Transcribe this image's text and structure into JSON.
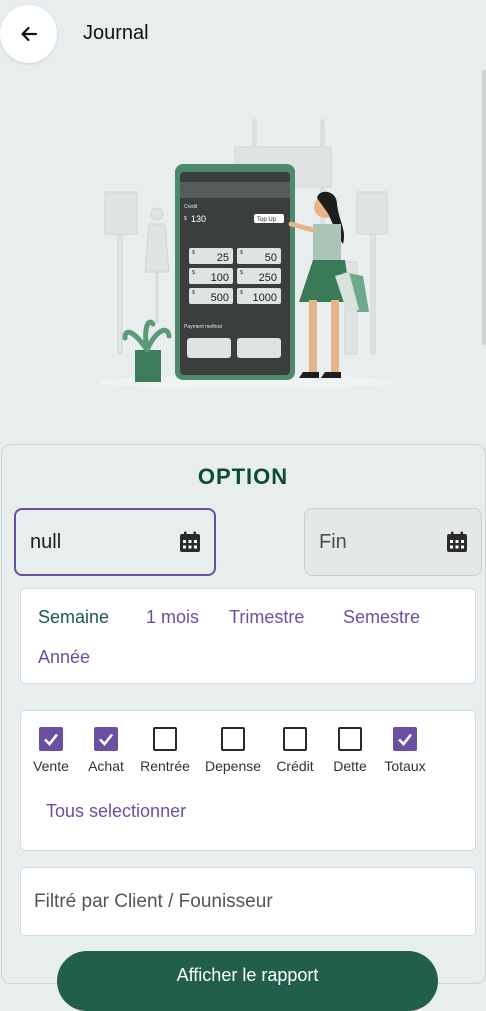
{
  "header": {
    "title": "Journal",
    "back_icon": "arrow-left-icon"
  },
  "illustration": {
    "credit_label": "Credit",
    "balance_currency": "$",
    "balance": "130",
    "top_up_label": "Top Up",
    "amount_currency": "$",
    "amounts": [
      "25",
      "50",
      "100",
      "250",
      "500",
      "1000"
    ],
    "payment_label": "Payment method"
  },
  "options": {
    "title": "OPTION",
    "start_date": {
      "value": "null",
      "icon": "calendar-icon"
    },
    "end_date": {
      "placeholder": "Fin",
      "icon": "calendar-icon"
    },
    "periods": [
      {
        "label": "Semaine",
        "active": true
      },
      {
        "label": "1 mois",
        "active": false
      },
      {
        "label": "Trimestre",
        "active": false
      },
      {
        "label": "Semestre",
        "active": false
      },
      {
        "label": "Année",
        "active": false
      }
    ],
    "checkboxes": [
      {
        "label": "Vente",
        "checked": true
      },
      {
        "label": "Achat",
        "checked": true
      },
      {
        "label": "Rentrée",
        "checked": false
      },
      {
        "label": "Depense",
        "checked": false
      },
      {
        "label": "Crédit",
        "checked": false
      },
      {
        "label": "Dette",
        "checked": false
      },
      {
        "label": "Totaux",
        "checked": true
      }
    ],
    "select_all_label": "Tous selectionner",
    "filter_placeholder": "Filtré par Client / Founisseur",
    "action_label": "Afficher le rapport"
  },
  "colors": {
    "accent_purple": "#6a4fa3",
    "brand_green": "#225f48",
    "title_green": "#0e4a37",
    "background": "#e8eeed"
  }
}
